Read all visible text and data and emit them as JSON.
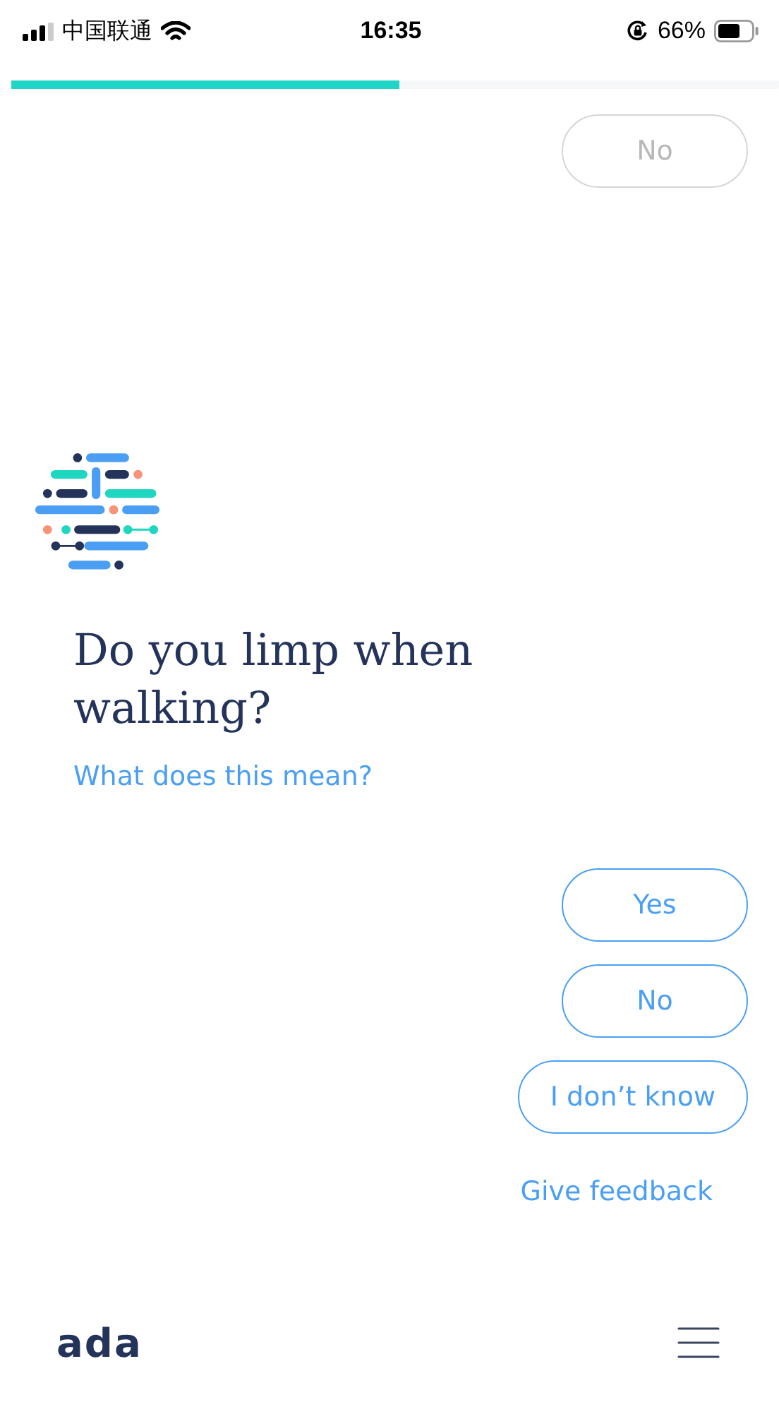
{
  "status_bar": {
    "carrier": "中国联通",
    "time": "16:35",
    "battery_percent": "66%"
  },
  "progress": {
    "level": 0.505
  },
  "previous_answer": {
    "label": "No",
    "disabled": true
  },
  "question": {
    "text": "Do you limp when walking?",
    "help_link": "What does this mean?"
  },
  "answers": [
    {
      "label": "Yes"
    },
    {
      "label": "No"
    },
    {
      "label": "I don’t know"
    }
  ],
  "feedback_link": "Give feedback",
  "footer": {
    "logo": "ada"
  }
}
